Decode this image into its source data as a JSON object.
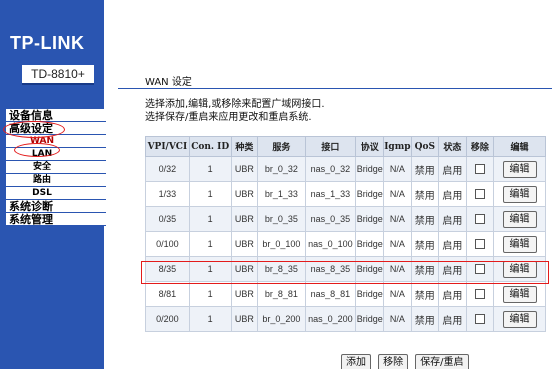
{
  "brand": {
    "logo": "TP-LINK",
    "model": "TD-8810+"
  },
  "sidebar": {
    "items": [
      {
        "label": "设备信息",
        "type": "main"
      },
      {
        "label": "高级设定",
        "type": "main"
      },
      {
        "label": "WAN",
        "type": "sub"
      },
      {
        "label": "LAN",
        "type": "sub"
      },
      {
        "label": "安全",
        "type": "sub"
      },
      {
        "label": "路由",
        "type": "sub"
      },
      {
        "label": "DSL",
        "type": "sub"
      },
      {
        "label": "系统诊断",
        "type": "main"
      },
      {
        "label": "系统管理",
        "type": "main"
      }
    ]
  },
  "page": {
    "title": "WAN 设定",
    "desc_line1": "选择添加,编辑,或移除来配置广域网接口.",
    "desc_line2": "选择保存/重启来应用更改和重启系统."
  },
  "table": {
    "headers": [
      "VPI/VCI",
      "Con. ID",
      "种类",
      "服务",
      "接口",
      "协议",
      "Igmp",
      "QoS",
      "状态",
      "移除",
      "编辑"
    ],
    "rows": [
      {
        "vpivci": "0/32",
        "conid": "1",
        "type": "UBR",
        "service": "br_0_32",
        "iface": "nas_0_32",
        "proto": "Bridge",
        "igmp": "N/A",
        "qos": "禁用",
        "status": "启用",
        "edit": "编辑"
      },
      {
        "vpivci": "1/33",
        "conid": "1",
        "type": "UBR",
        "service": "br_1_33",
        "iface": "nas_1_33",
        "proto": "Bridge",
        "igmp": "N/A",
        "qos": "禁用",
        "status": "启用",
        "edit": "编辑"
      },
      {
        "vpivci": "0/35",
        "conid": "1",
        "type": "UBR",
        "service": "br_0_35",
        "iface": "nas_0_35",
        "proto": "Bridge",
        "igmp": "N/A",
        "qos": "禁用",
        "status": "启用",
        "edit": "编辑"
      },
      {
        "vpivci": "0/100",
        "conid": "1",
        "type": "UBR",
        "service": "br_0_100",
        "iface": "nas_0_100",
        "proto": "Bridge",
        "igmp": "N/A",
        "qos": "禁用",
        "status": "启用",
        "edit": "编辑"
      },
      {
        "vpivci": "8/35",
        "conid": "1",
        "type": "UBR",
        "service": "br_8_35",
        "iface": "nas_8_35",
        "proto": "Bridge",
        "igmp": "N/A",
        "qos": "禁用",
        "status": "启用",
        "edit": "编辑"
      },
      {
        "vpivci": "8/81",
        "conid": "1",
        "type": "UBR",
        "service": "br_8_81",
        "iface": "nas_8_81",
        "proto": "Bridge",
        "igmp": "N/A",
        "qos": "禁用",
        "status": "启用",
        "edit": "编辑"
      },
      {
        "vpivci": "0/200",
        "conid": "1",
        "type": "UBR",
        "service": "br_0_200",
        "iface": "nas_0_200",
        "proto": "Bridge",
        "igmp": "N/A",
        "qos": "禁用",
        "status": "启用",
        "edit": "编辑"
      }
    ]
  },
  "buttons": {
    "add": "添加",
    "remove": "移除",
    "save": "保存/重启"
  },
  "colors": {
    "sidebar_bg": "#2a55b1",
    "header_bg": "#dde4ef",
    "row_alt": "#eef2f8",
    "highlight": "#e31b1b"
  }
}
